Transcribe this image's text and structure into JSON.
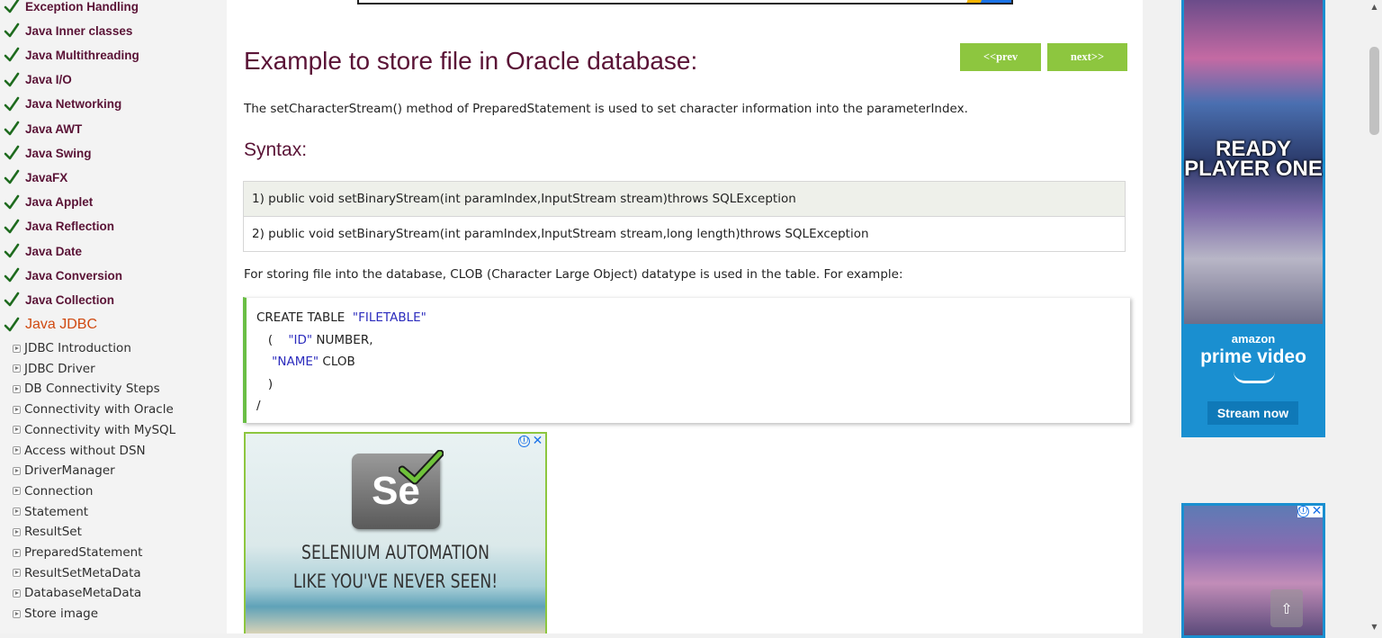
{
  "sidebar": {
    "categories": [
      "Exception Handling",
      "Java Inner classes",
      "Java Multithreading",
      "Java I/O",
      "Java Networking",
      "Java AWT",
      "Java Swing",
      "JavaFX",
      "Java Applet",
      "Java Reflection",
      "Java Date",
      "Java Conversion",
      "Java Collection",
      "Java JDBC"
    ],
    "sub_items": [
      "JDBC Introduction",
      "JDBC Driver",
      "DB Connectivity Steps",
      "Connectivity with Oracle",
      "Connectivity with MySQL",
      "Access without DSN",
      "DriverManager",
      "Connection",
      "Statement",
      "ResultSet",
      "PreparedStatement",
      "ResultSetMetaData",
      "DatabaseMetaData",
      "Store image"
    ]
  },
  "nav": {
    "prev_label": "<<prev",
    "next_label": "next>>"
  },
  "content": {
    "title": "Example to store file in Oracle database:",
    "intro": "The setCharacterStream() method of PreparedStatement is used to set character information into the parameterIndex.",
    "syntax_heading": "Syntax:",
    "syntax_rows": [
      "1) public void setBinaryStream(int paramIndex,InputStream stream)throws SQLException",
      "2) public void setBinaryStream(int paramIndex,InputStream stream,long length)throws SQLException"
    ],
    "storing_text": "For storing file into the database, CLOB (Character Large Object) datatype is used in the table. For example:",
    "code": {
      "line1_kw": "CREATE TABLE  ",
      "line1_str": "\"FILETABLE\"",
      "line2_pre": "   (    ",
      "line2_str": "\"ID\"",
      "line2_post": " NUMBER,",
      "line3_pre": "    ",
      "line3_str": "\"NAME\"",
      "line3_post": " CLOB",
      "line4": "   )",
      "line5": "/"
    }
  },
  "ads": {
    "selenium_line1": "SELENIUM AUTOMATION",
    "selenium_line2": "LIKE YOU'VE NEVER SEEN!",
    "selenium_logo": "Se",
    "prime_movie": "READY PLAYER ONE",
    "prime_brand": "amazon",
    "prime_product": "prime video",
    "prime_cta": "Stream now",
    "info_icon": "ⓘ",
    "close_icon": "✕"
  },
  "icons": {
    "check": "checkmark-icon",
    "expand": "expand-icon",
    "scroll_top": "⇧",
    "scroll_up": "▲",
    "scroll_down": "▼"
  },
  "colors": {
    "heading": "#5a1336",
    "active_category": "#d04a11",
    "nav_button": "#8dc63f",
    "code_border": "#6abe45",
    "code_string": "#2b2bbd"
  }
}
